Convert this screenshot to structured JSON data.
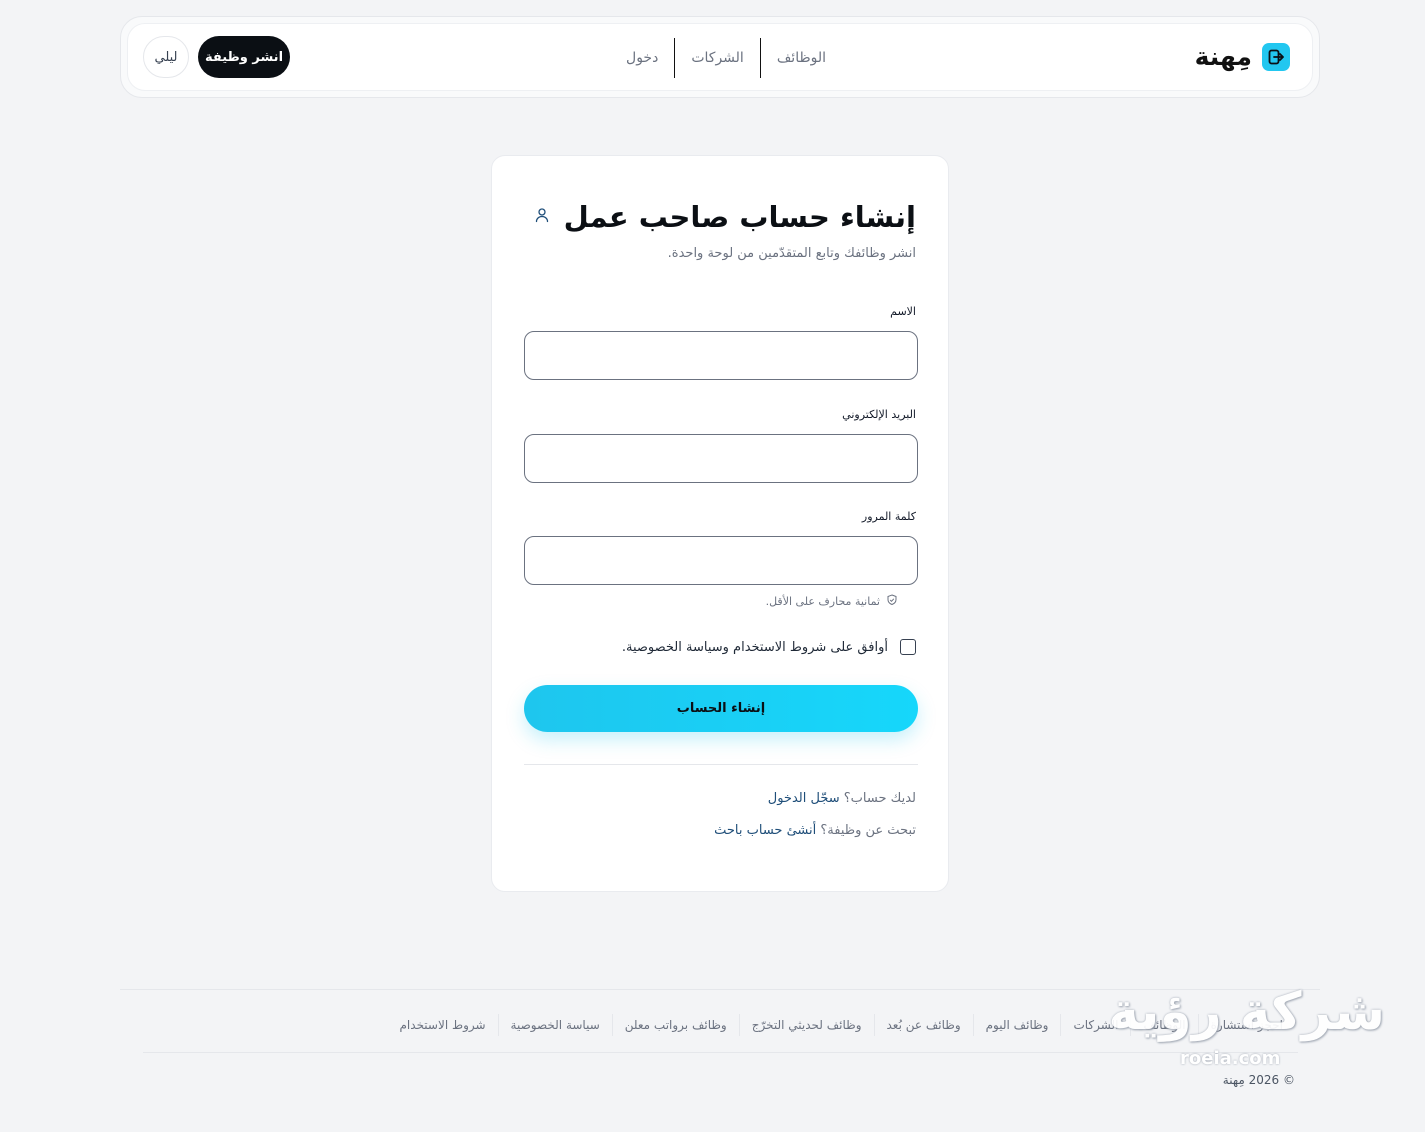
{
  "header": {
    "brand": "مِهنة",
    "nav": [
      "الوظائف",
      "الشركات",
      "دخول"
    ],
    "post_job": "انشر وظيفة",
    "theme": "ليلي"
  },
  "form": {
    "title": "إنشاء حساب صاحب عمل",
    "subtitle": "انشر وظائفك وتابع المتقدّمين من لوحة واحدة.",
    "name_label": "الاسم",
    "email_label": "البريد الإلكتروني",
    "password_label": "كلمة المرور",
    "password_hint": "ثمانية محارف على الأقل.",
    "terms": "أوافق على شروط الاستخدام وسياسة الخصوصية.",
    "submit": "إنشاء الحساب",
    "have_account": "لديك حساب؟",
    "login_link": "سجّل الدخول",
    "seeking_job": "تبحث عن وظيفة؟",
    "seeker_link": "أنشئ حساب باحث"
  },
  "footer": {
    "links": [
      "احجز استشارة",
      "الوظائف",
      "الشركات",
      "وظائف اليوم",
      "وظائف عن بُعد",
      "وظائف لحديثي التخرّج",
      "وظائف برواتب معلن",
      "سياسة الخصوصية",
      "شروط الاستخدام"
    ],
    "copyright": "© 2026 مِهنة"
  },
  "watermark": {
    "main": "شركة رؤية",
    "domain": "roeia.com"
  },
  "colors": {
    "accent": "#22c7f0",
    "dark": "#0b0f14",
    "link": "#1f4e79"
  }
}
